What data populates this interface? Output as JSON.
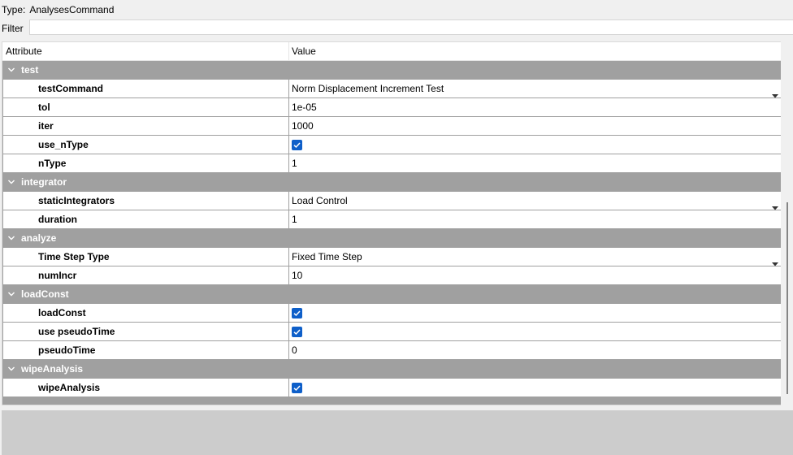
{
  "type_line": {
    "label": "Type:",
    "value": "AnalysesCommand"
  },
  "filter": {
    "label": "Filter",
    "value": "",
    "placeholder": ""
  },
  "columns": {
    "attribute": "Attribute",
    "value": "Value"
  },
  "groups": [
    {
      "name": "test",
      "rows": [
        {
          "name": "testCommand",
          "kind": "dropdown",
          "value": "Norm Displacement Increment Test"
        },
        {
          "name": "tol",
          "kind": "text",
          "value": "1e-05"
        },
        {
          "name": "iter",
          "kind": "text",
          "value": "1000"
        },
        {
          "name": "use_nType",
          "kind": "checkbox",
          "value": "checked"
        },
        {
          "name": "nType",
          "kind": "text",
          "value": "1"
        }
      ]
    },
    {
      "name": "integrator",
      "rows": [
        {
          "name": "staticIntegrators",
          "kind": "dropdown",
          "value": "Load Control"
        },
        {
          "name": "duration",
          "kind": "text",
          "value": "1"
        }
      ]
    },
    {
      "name": "analyze",
      "rows": [
        {
          "name": "Time Step Type",
          "kind": "dropdown",
          "value": "Fixed Time Step"
        },
        {
          "name": "numIncr",
          "kind": "text",
          "value": "10"
        }
      ]
    },
    {
      "name": "loadConst",
      "rows": [
        {
          "name": "loadConst",
          "kind": "checkbox",
          "value": "checked"
        },
        {
          "name": "use pseudoTime",
          "kind": "checkbox",
          "value": "checked"
        },
        {
          "name": "pseudoTime",
          "kind": "text",
          "value": "0"
        }
      ]
    },
    {
      "name": "wipeAnalysis",
      "rows": [
        {
          "name": "wipeAnalysis",
          "kind": "checkbox",
          "value": "checked"
        }
      ]
    }
  ],
  "colors": {
    "group_header": "#a0a0a0",
    "checkbox": "#0e5fc9",
    "bottom_pane": "#cccccc"
  },
  "icons": {
    "group_toggle": "chevron-down-icon",
    "dropdown": "dropdown-arrow-icon",
    "checkbox": "checkmark-icon"
  }
}
